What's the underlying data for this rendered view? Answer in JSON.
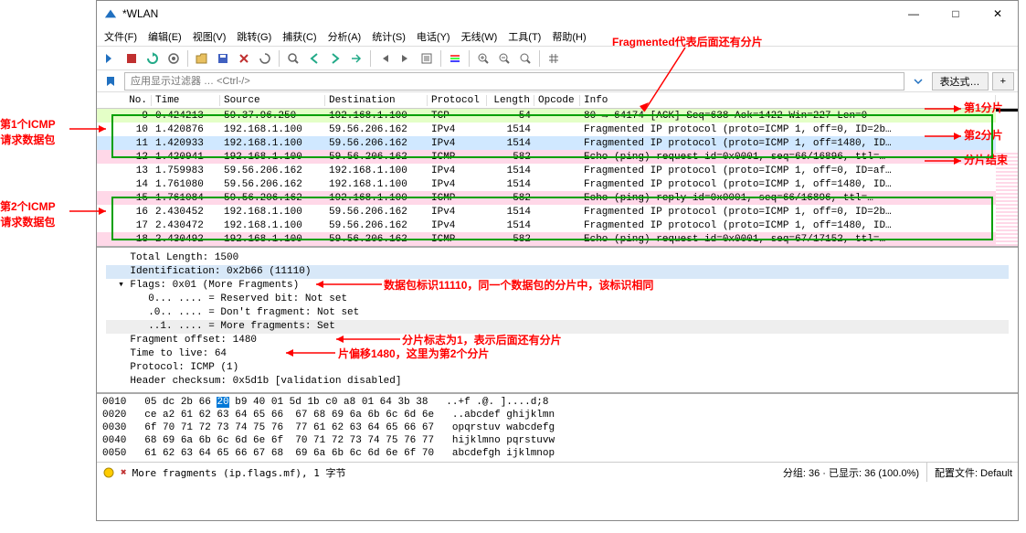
{
  "window": {
    "title": "*WLAN",
    "minimize": "—",
    "maximize": "□",
    "close": "✕"
  },
  "menu": {
    "file": "文件(F)",
    "edit": "编辑(E)",
    "view": "视图(V)",
    "jump": "跳转(G)",
    "capture": "捕获(C)",
    "analyze": "分析(A)",
    "stats": "统计(S)",
    "telephony": "电话(Y)",
    "wireless": "无线(W)",
    "tools": "工具(T)",
    "help": "帮助(H)"
  },
  "filter": {
    "placeholder": "应用显示过滤器 … <Ctrl-/>",
    "expr": "表达式…",
    "plus": "+"
  },
  "columns": {
    "no": "No.",
    "time": "Time",
    "src": "Source",
    "dst": "Destination",
    "proto": "Protocol",
    "len": "Length",
    "opcode": "Opcode",
    "info": "Info"
  },
  "packets": [
    {
      "no": "9",
      "time": "0.424213",
      "src": "59.37.96.250",
      "dst": "192.168.1.100",
      "proto": "TCP",
      "len": "54",
      "info": "80 → 64174 [ACK] Seq=638 Ack=1422 Win=227 Len=0",
      "bg": "bg-green"
    },
    {
      "no": "10",
      "time": "1.420876",
      "src": "192.168.1.100",
      "dst": "59.56.206.162",
      "proto": "IPv4",
      "len": "1514",
      "info": "Fragmented IP protocol (proto=ICMP 1, off=0, ID=2b…",
      "bg": "bg-white"
    },
    {
      "no": "11",
      "time": "1.420933",
      "src": "192.168.1.100",
      "dst": "59.56.206.162",
      "proto": "IPv4",
      "len": "1514",
      "info": "Fragmented IP protocol (proto=ICMP 1, off=1480, ID…",
      "bg": "bg-blue"
    },
    {
      "no": "12",
      "time": "1.420941",
      "src": "192.168.1.100",
      "dst": "59.56.206.162",
      "proto": "ICMP",
      "len": "582",
      "info": "Echo (ping) request  id=0x0001, seq=66/16896, ttl=…",
      "bg": "bg-pink"
    },
    {
      "no": "13",
      "time": "1.759983",
      "src": "59.56.206.162",
      "dst": "192.168.1.100",
      "proto": "IPv4",
      "len": "1514",
      "info": "Fragmented IP protocol (proto=ICMP 1, off=0, ID=af…",
      "bg": "bg-white"
    },
    {
      "no": "14",
      "time": "1.761080",
      "src": "59.56.206.162",
      "dst": "192.168.1.100",
      "proto": "IPv4",
      "len": "1514",
      "info": "Fragmented IP protocol (proto=ICMP 1, off=1480, ID…",
      "bg": "bg-white"
    },
    {
      "no": "15",
      "time": "1.761084",
      "src": "59.56.206.162",
      "dst": "192.168.1.100",
      "proto": "ICMP",
      "len": "582",
      "info": "Echo (ping) reply    id=0x0001, seq=66/16896, ttl=…",
      "bg": "bg-pink"
    },
    {
      "no": "16",
      "time": "2.430452",
      "src": "192.168.1.100",
      "dst": "59.56.206.162",
      "proto": "IPv4",
      "len": "1514",
      "info": "Fragmented IP protocol (proto=ICMP 1, off=0, ID=2b…",
      "bg": "bg-white"
    },
    {
      "no": "17",
      "time": "2.430472",
      "src": "192.168.1.100",
      "dst": "59.56.206.162",
      "proto": "IPv4",
      "len": "1514",
      "info": "Fragmented IP protocol (proto=ICMP 1, off=1480, ID…",
      "bg": "bg-white"
    },
    {
      "no": "18",
      "time": "2.430492",
      "src": "192.168.1.100",
      "dst": "59.56.206.162",
      "proto": "ICMP",
      "len": "582",
      "info": "Echo (ping) request  id=0x0001, seq=67/17152, ttl=…",
      "bg": "bg-pink"
    }
  ],
  "details": {
    "l0": "    Total Length: 1500",
    "l1": "    Identification: 0x2b66 (11110)",
    "l2": "  ▾ Flags: 0x01 (More Fragments)",
    "l3": "       0... .... = Reserved bit: Not set",
    "l4": "       .0.. .... = Don't fragment: Not set",
    "l5": "       ..1. .... = More fragments: Set",
    "l6": "    Fragment offset: 1480",
    "l7": "    Time to live: 64",
    "l8": "    Protocol: ICMP (1)",
    "l9": "    Header checksum: 0x5d1b [validation disabled]"
  },
  "hex": {
    "r0o": "0010",
    "r0h": "05 dc 2b 66 ",
    "r0hl": "20",
    "r0h2": " b9 40 01 5d 1b c0 a8 01 64 3b 38",
    "r0a": "   ..+f .@. ]....d;8",
    "r1o": "0020",
    "r1h": "ce a2 61 62 63 64 65 66  67 68 69 6a 6b 6c 6d 6e",
    "r1a": "   ..abcdef ghijklmn",
    "r2o": "0030",
    "r2h": "6f 70 71 72 73 74 75 76  77 61 62 63 64 65 66 67",
    "r2a": "   opqrstuv wabcdefg",
    "r3o": "0040",
    "r3h": "68 69 6a 6b 6c 6d 6e 6f  70 71 72 73 74 75 76 77",
    "r3a": "   hijklmno pqrstuvw",
    "r4o": "0050",
    "r4h": "61 62 63 64 65 66 67 68  69 6a 6b 6c 6d 6e 6f 70",
    "r4a": "   abcdefgh ijklmnop"
  },
  "status": {
    "text": "More fragments (ip.flags.mf), 1 字节",
    "pkts": "分组: 36 · 已显示: 36 (100.0%)",
    "profile": "配置文件: Default"
  },
  "annotations": {
    "a1": "Fragmented代表后面还有分片",
    "a2": "第1分片",
    "a3": "第2分片",
    "a4": "分片结束",
    "a5": "第1个ICMP\n请求数据包",
    "a6": "第2个ICMP\n请求数据包",
    "a7": "数据包标识11110，同一个数据包的分片中，该标识相同",
    "a8": "分片标志为1，表示后面还有分片",
    "a9": "片偏移1480，这里为第2个分片"
  }
}
